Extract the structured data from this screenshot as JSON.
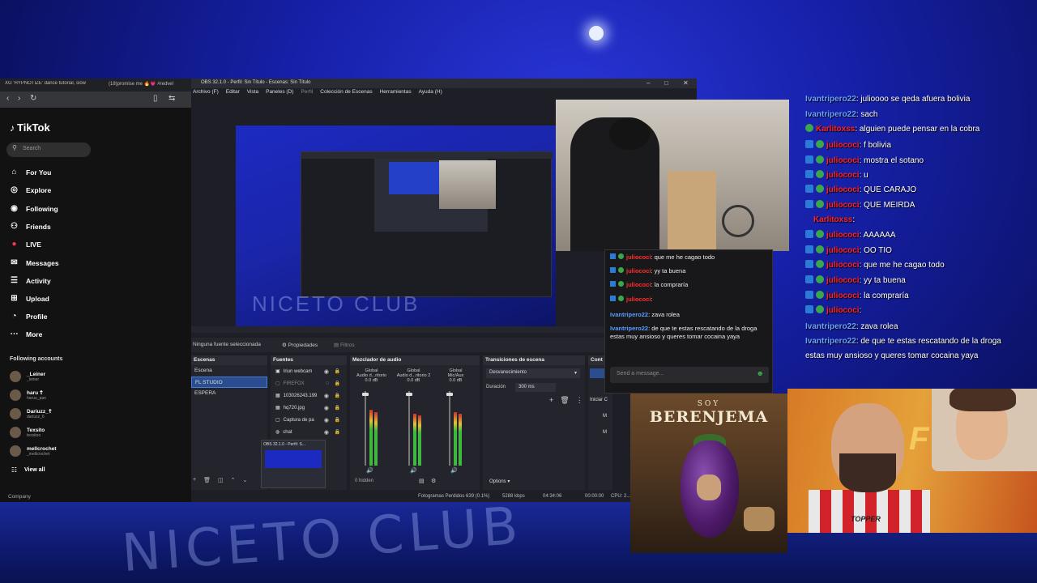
{
  "background": {
    "floor_text": "NICETO CLUB"
  },
  "browser": {
    "tabs": [
      "XG 'HYPNOTIZE' dance tutorial, slow",
      "(18)promise me 🔥💗 #redvel"
    ],
    "tiktok": {
      "logo": "TikTok",
      "search_placeholder": "Search",
      "nav": [
        {
          "label": "For You",
          "icon": "home-icon"
        },
        {
          "label": "Explore",
          "icon": "compass-icon"
        },
        {
          "label": "Following",
          "icon": "following-icon"
        },
        {
          "label": "Friends",
          "icon": "friends-icon"
        },
        {
          "label": "LIVE",
          "icon": "live-icon"
        },
        {
          "label": "Messages",
          "icon": "messages-icon"
        },
        {
          "label": "Activity",
          "icon": "activity-icon"
        },
        {
          "label": "Upload",
          "icon": "upload-icon"
        },
        {
          "label": "Profile",
          "icon": "profile-icon"
        },
        {
          "label": "More",
          "icon": "more-icon"
        }
      ],
      "following_title": "Following accounts",
      "accounts": [
        {
          "name": "_Leiner",
          "handle": "_leiner"
        },
        {
          "name": "haru ☦",
          "handle": "haruu_pan"
        },
        {
          "name": "Dariuzz_☦",
          "handle": "dariuzz_6"
        },
        {
          "name": "Texsito",
          "handle": "texsitoo"
        },
        {
          "name": "mellcrochet",
          "handle": "_mellcrochet"
        }
      ],
      "view_all": "View all",
      "company": "Company"
    }
  },
  "obs": {
    "title": "OBS 32.1.0 - Perfil: Sin Título - Escenas: Sin Título",
    "menu": [
      "Archivo (F)",
      "Editar",
      "Vista",
      "Paneles (D)",
      "Perfil",
      "Colección de Escenas",
      "Herramientas",
      "Ayuda (H)"
    ],
    "preview_floor_text": "NICETO CLUB",
    "props_bar": {
      "no_source": "Ninguna fuente seleccionada",
      "properties": "Propiedades",
      "filters": "Filtros"
    },
    "scenes": {
      "title": "Escenas",
      "items": [
        "Escena",
        "FL STUDIO",
        "ESPERA"
      ],
      "selected": "FL STUDIO"
    },
    "sources": {
      "title": "Fuentes",
      "items": [
        {
          "label": "Iriun webcam",
          "dim": false
        },
        {
          "label": "FIREFOX",
          "dim": true
        },
        {
          "label": "103026243.199",
          "dim": false
        },
        {
          "label": "hq720.jpg",
          "dim": false
        },
        {
          "label": "Captura de pa",
          "dim": false
        },
        {
          "label": "chat",
          "dim": false
        }
      ],
      "drag_label": "OBS 32.1.0 - Perfil: S..."
    },
    "mixer": {
      "title": "Mezclador de audio",
      "channels": [
        {
          "top": "Global",
          "name": "Audio d...ritorio",
          "db": "0.0 dB",
          "level": 0.75
        },
        {
          "top": "Global",
          "name": "Audio d...ritorio 2",
          "db": "0.0 dB",
          "level": 0.7
        },
        {
          "top": "Global",
          "name": "Mic/Aux",
          "db": "0.0 dB",
          "level": 0.72
        }
      ],
      "hidden": "0 hidden"
    },
    "transitions": {
      "title": "Transiciones de escena",
      "selected": "Desvanecimiento",
      "duration_label": "Duración",
      "duration_value": "300 ms"
    },
    "controls": {
      "title": "Cont",
      "start": "Iniciar C",
      "m1": "M",
      "m2": "M"
    },
    "options": "Options",
    "status": {
      "frames": "Fotogramas Perdidos 639 (0.1%)",
      "bitrate": "5288 kbps",
      "live_time": "04:34:06",
      "rec_time": "00:00:00",
      "cpu": "CPU: 2..."
    }
  },
  "obs_chat": {
    "lines": [
      {
        "user": "juliococi",
        "color": "red",
        "text": ": que me he cagao todo"
      },
      {
        "user": "juliococi",
        "color": "red",
        "text": ": yy ta buena"
      },
      {
        "user": "juliococi",
        "color": "red",
        "text": ": la compraría"
      },
      {
        "user": "juliococi",
        "color": "red",
        "text": ":"
      },
      {
        "user": "Ivantripero22",
        "color": "blue",
        "text": ": zava rolea"
      },
      {
        "user": "Ivantripero22",
        "color": "blue",
        "text": ": de que te estas rescatando de la droga  estas muy ansioso y queres tomar cocaina yaya"
      }
    ],
    "input_placeholder": "Send a message..."
  },
  "overlay_chat": {
    "lines": [
      {
        "user": "Ivantripero22",
        "color": "blue",
        "badge": "none",
        "text": ": julioooo se qeda afuera bolivia"
      },
      {
        "user": "Ivantripero22",
        "color": "blue",
        "badge": "none",
        "text": ": sach"
      },
      {
        "user": "Karlitoxss",
        "color": "red",
        "badge": "green",
        "text": ": alguien puede pensar en la cobra"
      },
      {
        "user": "juliococi",
        "color": "red",
        "badge": "green",
        "text": ": f bolivia"
      },
      {
        "user": "juliococi",
        "color": "red",
        "badge": "green",
        "text": ": mostra el sotano"
      },
      {
        "user": "juliococi",
        "color": "red",
        "badge": "green",
        "text": ": u"
      },
      {
        "user": "juliococi",
        "color": "red",
        "badge": "green",
        "text": ": QUE CARAJO"
      },
      {
        "user": "juliococi",
        "color": "red",
        "badge": "green",
        "text": ": QUE MEIRDA"
      },
      {
        "user": "Karlitoxss",
        "color": "red",
        "badge": "none",
        "text": ":"
      },
      {
        "user": "juliococi",
        "color": "red",
        "badge": "green",
        "text": ": AAAAAA"
      },
      {
        "user": "juliococi",
        "color": "red",
        "badge": "green",
        "text": ": OO TIO"
      },
      {
        "user": "juliococi",
        "color": "red",
        "badge": "green",
        "text": ": que me he cagao todo"
      },
      {
        "user": "juliococi",
        "color": "red",
        "badge": "green",
        "text": ": yy ta buena"
      },
      {
        "user": "juliococi",
        "color": "red",
        "badge": "green",
        "text": ": la compraría"
      },
      {
        "user": "juliococi",
        "color": "red",
        "badge": "green",
        "text": ":"
      },
      {
        "user": "Ivantripero22",
        "color": "blue",
        "badge": "none",
        "text": ": zava rolea"
      },
      {
        "user": "Ivantripero22",
        "color": "blue",
        "badge": "none",
        "text": ": de que te estas rescatando de la droga"
      },
      {
        "user": "",
        "color": "none",
        "badge": "none",
        "text": "estas muy ansioso y queres tomar cocaina yaya"
      }
    ]
  },
  "thumbnail_soy": {
    "top": "SOY",
    "main": "BERENJEMA"
  },
  "thumbnail_face": {
    "shirt_text": "TOPPER",
    "big_text": "F"
  },
  "colors": {
    "red_user": "#ff2020",
    "blue_user": "#6aa0ff",
    "selected_scene": "#2a4d8f"
  }
}
